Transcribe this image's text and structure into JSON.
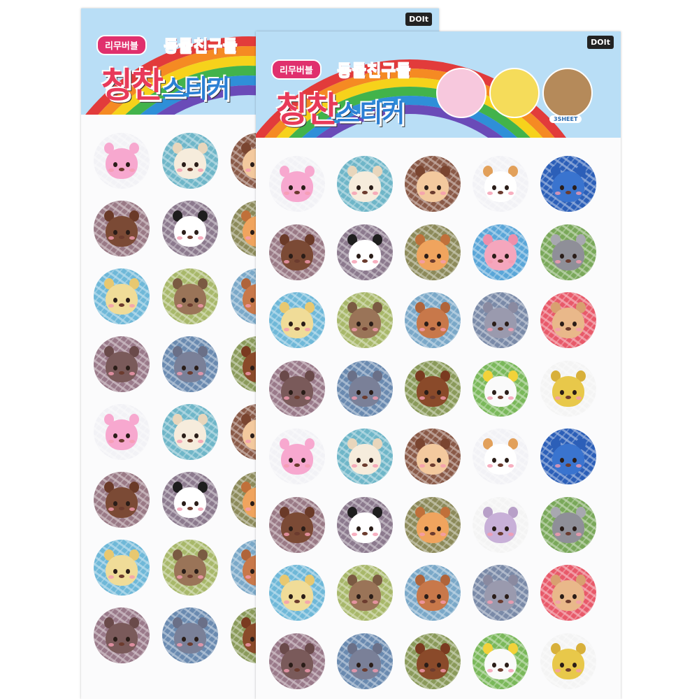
{
  "back_sheet": {
    "pill": "리무버블",
    "subtitle": "동물친구들",
    "title_big": "칭찬",
    "title_small": "스티커",
    "brand": "DOIt"
  },
  "front_sheet": {
    "pill": "리무버블",
    "subtitle": "동물친구들",
    "title_big": "칭찬",
    "title_small": "스티커",
    "brand": "DOIt",
    "preview_label": "3SHEET"
  },
  "colors": {
    "header": "#b9def6",
    "title": "#e83a5a",
    "subtitle": "#f24f8a",
    "pill": "#e0306d",
    "rainbow": [
      "#e23b3b",
      "#f58a23",
      "#f6d21b",
      "#42b34b",
      "#2f8fd8",
      "#6a4bb8"
    ]
  },
  "stickers": {
    "front_rows": [
      [
        "bunny",
        "sheep",
        "monkey",
        "cat",
        "blue-holo"
      ],
      [
        "bear",
        "panda",
        "lion",
        "pig",
        "koala"
      ],
      [
        "tiger",
        "raccoon",
        "deer",
        "mouse",
        "puppy"
      ],
      [
        "hedgehog",
        "rhino",
        "brown-bear",
        "chick",
        "giraffe"
      ],
      [
        "bunny",
        "sheep",
        "monkey",
        "cat",
        "blue-holo"
      ],
      [
        "bear",
        "panda",
        "lion",
        "giraffe-text",
        "koala"
      ],
      [
        "tiger",
        "raccoon",
        "deer",
        "mouse",
        "puppy"
      ],
      [
        "hedgehog",
        "rhino",
        "brown-bear",
        "chick",
        "giraffe"
      ]
    ],
    "back_rows": [
      [
        "bunny",
        "sheep",
        "monkey"
      ],
      [
        "bear",
        "panda",
        "lion"
      ],
      [
        "tiger",
        "raccoon",
        "deer"
      ],
      [
        "hedgehog",
        "rhino",
        "brown-bear"
      ],
      [
        "bunny",
        "sheep",
        "monkey"
      ],
      [
        "bear",
        "panda",
        "lion"
      ],
      [
        "tiger",
        "raccoon",
        "deer"
      ],
      [
        "hedgehog",
        "rhino",
        "brown-bear"
      ]
    ],
    "palette": {
      "bunny": {
        "bg": "#f2f2f6",
        "face": "#f7a8cf",
        "ear": "#f7a8cf"
      },
      "sheep": {
        "bg": "#6fb6c8",
        "face": "#f6ecdc",
        "ear": "#e8d6bc"
      },
      "monkey": {
        "bg": "#8a5a48",
        "face": "#f3c99e",
        "ear": "#7a4530"
      },
      "cat": {
        "bg": "#f2f2f6",
        "face": "#ffffff",
        "ear": "#e2a05a"
      },
      "blue-holo": {
        "bg": "#2c5fb8",
        "face": "#3a74cf",
        "ear": "#2c5fb8"
      },
      "bear": {
        "bg": "#9a7a86",
        "face": "#7b4a35",
        "ear": "#6a3a28"
      },
      "panda": {
        "bg": "#8c7a8e",
        "face": "#ffffff",
        "ear": "#1e1e1e"
      },
      "lion": {
        "bg": "#8c8a5a",
        "face": "#f0a45e",
        "ear": "#c0703a"
      },
      "pig": {
        "bg": "#5aa6d8",
        "face": "#f5a6bd",
        "ear": "#ee8fab"
      },
      "koala": {
        "bg": "#7aa85a",
        "face": "#8f8f98",
        "ear": "#a8a8b0"
      },
      "tiger": {
        "bg": "#6fb8d8",
        "face": "#f0dc98",
        "ear": "#e8c870"
      },
      "raccoon": {
        "bg": "#a8b86a",
        "face": "#9a7458",
        "ear": "#7a5a42"
      },
      "deer": {
        "bg": "#7aa8c8",
        "face": "#c8784a",
        "ear": "#b0643a"
      },
      "mouse": {
        "bg": "#7a8aa8",
        "face": "#9a9aae",
        "ear": "#8a8aa0"
      },
      "puppy": {
        "bg": "#e85a6a",
        "face": "#e9b88a",
        "ear": "#d8a070"
      },
      "hedgehog": {
        "bg": "#9a7a8a",
        "face": "#7a5a5a",
        "ear": "#6a4a4a"
      },
      "rhino": {
        "bg": "#6a8ab0",
        "face": "#7a8098",
        "ear": "#6a7088"
      },
      "brown-bear": {
        "bg": "#8a9a5a",
        "face": "#8a4a2a",
        "ear": "#7a3a20"
      },
      "chick": {
        "bg": "#7ab85a",
        "face": "#fafafa",
        "ear": "#f2d23a"
      },
      "giraffe": {
        "bg": "#f4f4f4",
        "face": "#e8c84a",
        "ear": "#d8b03a"
      },
      "giraffe-text": {
        "bg": "#f4f4f4",
        "face": "#c8b0d8",
        "ear": "#b8a0c8"
      }
    }
  }
}
